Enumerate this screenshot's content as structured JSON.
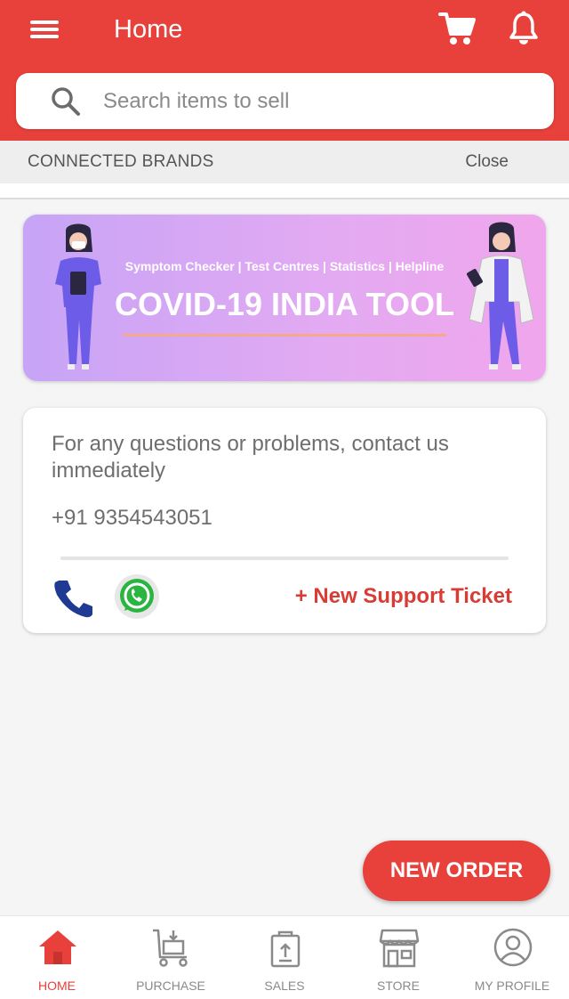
{
  "app_bar": {
    "title": "Home",
    "icons": [
      "menu-icon",
      "cart-icon",
      "bell-icon"
    ],
    "color": "#e8403a"
  },
  "search": {
    "placeholder": "Search items to sell"
  },
  "connected_brands": {
    "title": "CONNECTED BRANDS",
    "close_label": "Close"
  },
  "banner": {
    "subtitle": "Symptom Checker | Test Centres | Statistics | Helpline",
    "title": "COVID-19 INDIA TOOL"
  },
  "support": {
    "message": "For any questions or problems, contact us immediately",
    "phone": "+91 9354543051",
    "icons": [
      "phone-icon",
      "whatsapp-icon"
    ],
    "ticket_label": "+ New Support Ticket"
  },
  "new_order_label": "NEW ORDER",
  "bottom_nav": {
    "items": [
      {
        "label": "HOME",
        "icon": "home-icon",
        "active": true
      },
      {
        "label": "PURCHASE",
        "icon": "trolley-icon",
        "active": false
      },
      {
        "label": "SALES",
        "icon": "shopping-bag-icon",
        "active": false
      },
      {
        "label": "STORE",
        "icon": "store-icon",
        "active": false
      },
      {
        "label": "MY PROFILE",
        "icon": "profile-icon",
        "active": false
      }
    ]
  }
}
